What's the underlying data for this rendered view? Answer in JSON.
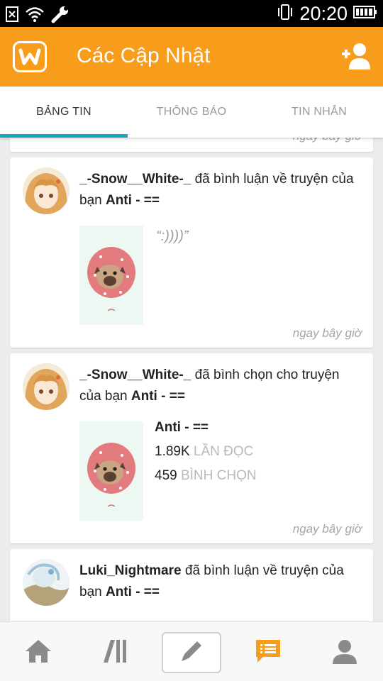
{
  "status_bar": {
    "time": "20:20"
  },
  "app_bar": {
    "title": "Các Cập Nhật"
  },
  "tabs": [
    {
      "label": "BẢNG TIN"
    },
    {
      "label": "THÔNG BÁO"
    },
    {
      "label": "TIN NHẮN"
    }
  ],
  "feed": {
    "partial_top_timestamp": "ngay bây giờ",
    "items": [
      {
        "username": "_-Snow__White-_",
        "action": " đã bình luận về truyện của bạn ",
        "story": "Anti - ==",
        "comment": "“:))))”",
        "timestamp": "ngay bây giờ"
      },
      {
        "username": "_-Snow__White-_",
        "action": " đã bình chọn cho truyện của bạn ",
        "story": "Anti - ==",
        "story_title": "Anti - ==",
        "reads_value": "1.89K",
        "reads_label": " LẦN ĐỌC",
        "votes_value": "459",
        "votes_label": " BÌNH CHỌN",
        "timestamp": "ngay bây giờ"
      },
      {
        "username": "Luki_Nightmare",
        "action": " đã bình luận về truyện của bạn ",
        "story": "Anti - =="
      }
    ]
  },
  "colors": {
    "app_bar": "#f89c1c",
    "tab_indicator": "#1ba7b5",
    "active_nav": "#f89c1c",
    "inactive_nav": "#8a8a8a"
  },
  "bottom_nav": [
    {
      "icon": "home-icon"
    },
    {
      "icon": "library-icon"
    },
    {
      "icon": "pencil-icon"
    },
    {
      "icon": "message-icon"
    },
    {
      "icon": "profile-icon"
    }
  ]
}
